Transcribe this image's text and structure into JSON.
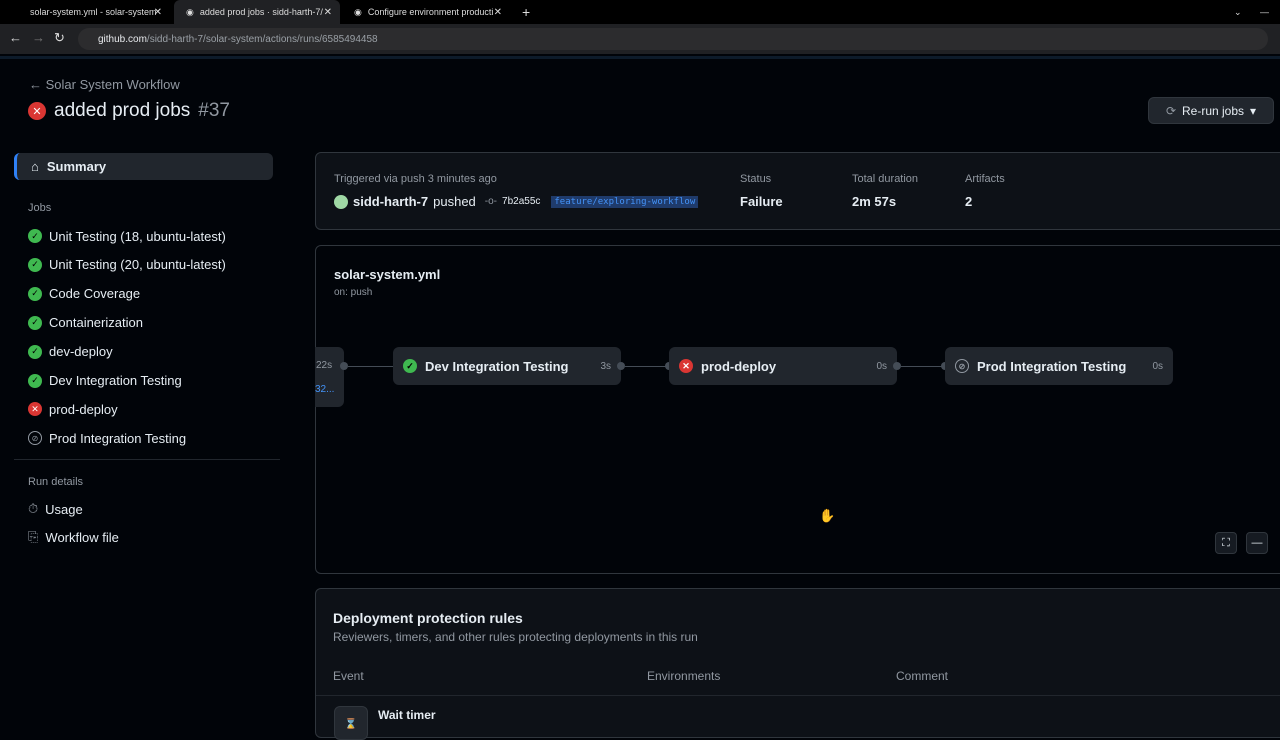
{
  "browser": {
    "tabs": [
      "solar-system.yml - solar-system",
      "added prod jobs · sidd-harth-7/",
      "Configure environment producti"
    ],
    "url_host": "github.com",
    "url_path": "/sidd-harth-7/solar-system/actions/runs/6585494458"
  },
  "header": {
    "back_label": "Solar System Workflow",
    "title": "added prod jobs",
    "run_number": "#37",
    "rerun_label": "Re-run jobs"
  },
  "sidebar": {
    "summary": "Summary",
    "jobs_heading": "Jobs",
    "jobs": [
      {
        "label": "Unit Testing (18, ubuntu-latest)",
        "status": "success"
      },
      {
        "label": "Unit Testing (20, ubuntu-latest)",
        "status": "success"
      },
      {
        "label": "Code Coverage",
        "status": "success"
      },
      {
        "label": "Containerization",
        "status": "success"
      },
      {
        "label": "dev-deploy",
        "status": "success"
      },
      {
        "label": "Dev Integration Testing",
        "status": "success"
      },
      {
        "label": "prod-deploy",
        "status": "failure"
      },
      {
        "label": "Prod Integration Testing",
        "status": "skipped"
      }
    ],
    "run_details_heading": "Run details",
    "usage": "Usage",
    "workflow_file": "Workflow file"
  },
  "summary": {
    "triggered": "Triggered via push 3 minutes ago",
    "actor": "sidd-harth-7",
    "action": "pushed",
    "commit": "7b2a55c",
    "branch": "feature/exploring-workflow",
    "status_label": "Status",
    "status": "Failure",
    "duration_label": "Total duration",
    "duration": "2m 57s",
    "artifacts_label": "Artifacts",
    "artifacts": "2"
  },
  "graph": {
    "file": "solar-system.yml",
    "trigger": "on: push",
    "partial_duration": "22s",
    "partial_link": "32...",
    "nodes": [
      {
        "label": "Dev Integration Testing",
        "duration": "3s"
      },
      {
        "label": "prod-deploy",
        "duration": "0s"
      },
      {
        "label": "Prod Integration Testing",
        "duration": "0s"
      }
    ]
  },
  "protection": {
    "title": "Deployment protection rules",
    "subtitle": "Reviewers, timers, and other rules protecting deployments in this run",
    "columns": [
      "Event",
      "Environments",
      "Comment"
    ],
    "row_event": "Wait timer"
  }
}
